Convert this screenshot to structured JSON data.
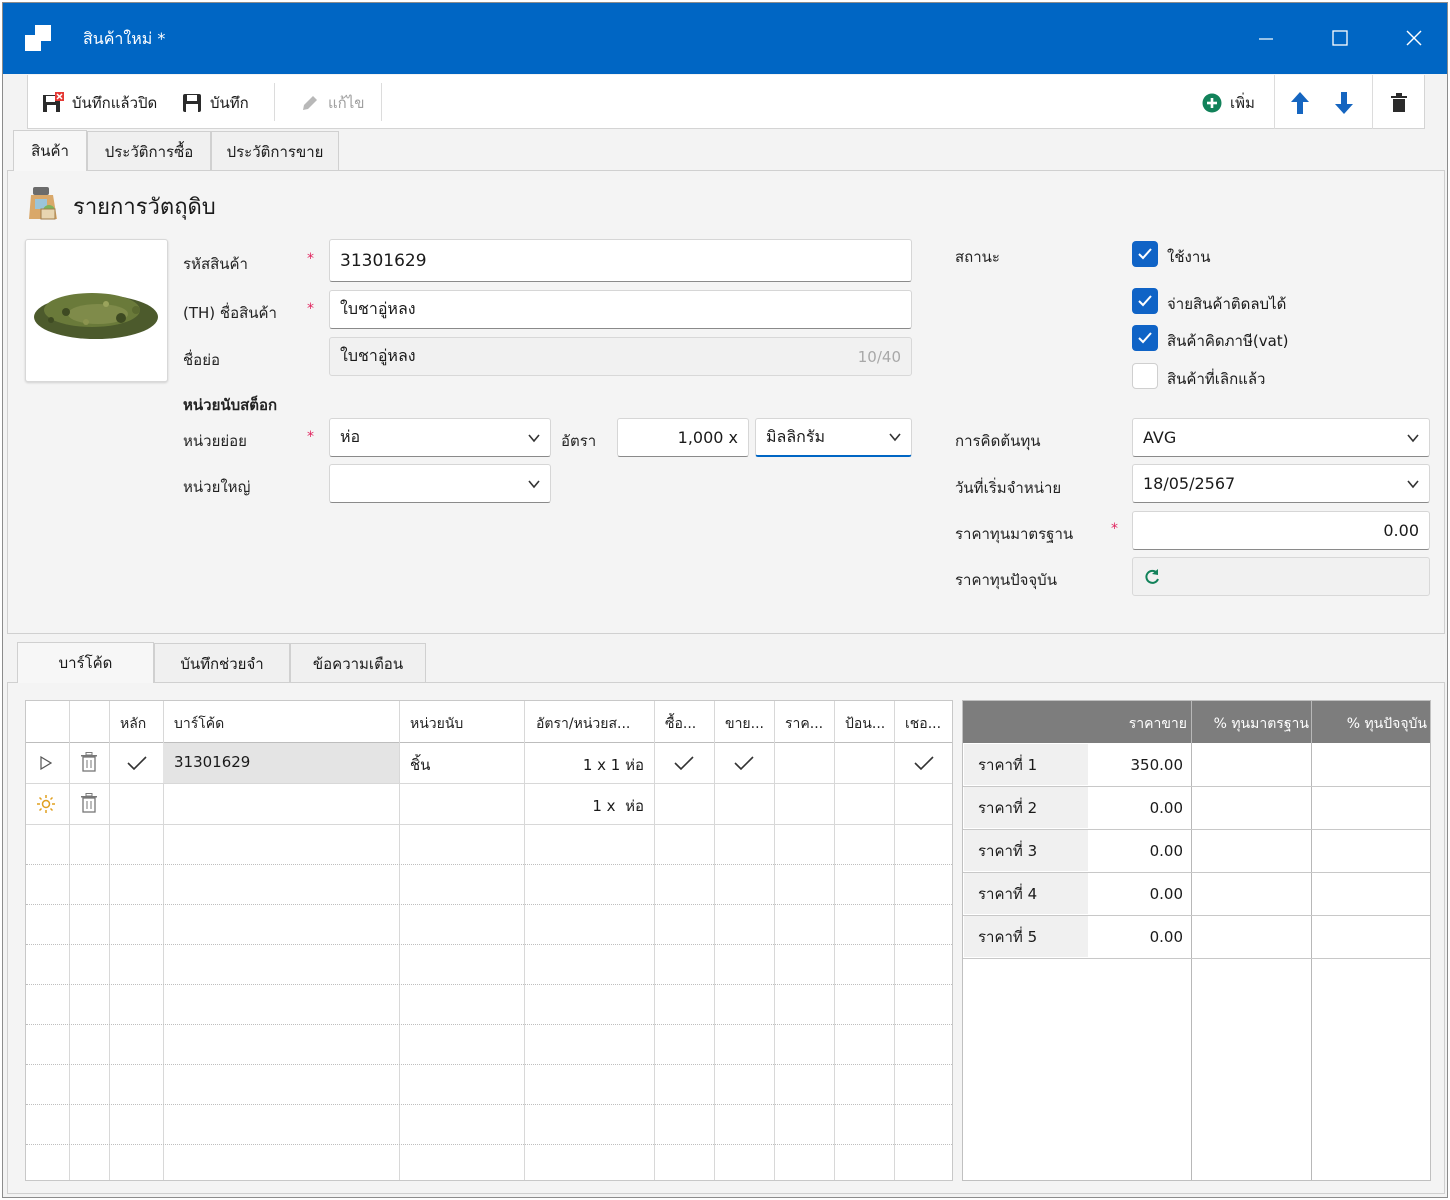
{
  "window": {
    "title": "สินค้าใหม่ *"
  },
  "toolbar": {
    "save_close": "บันทึกแล้วปิด",
    "save": "บันทึก",
    "edit": "แก้ไข",
    "add": "เพิ่ม"
  },
  "top_tabs": [
    "สินค้า",
    "ประวัติการซื้อ",
    "ประวัติการขาย"
  ],
  "section": {
    "title": "รายการวัตถุดิบ"
  },
  "form": {
    "code_label": "รหัสสินค้า",
    "code_value": "31301629",
    "name_label": "(TH) ชื่อสินค้า",
    "name_value": "ใบชาอู่หลง",
    "short_label": "ชื่อย่อ",
    "short_value": "ใบชาอู่หลง",
    "short_counter": "10/40",
    "stock_unit_heading": "หน่วยนับสต็อก",
    "small_unit_label": "หน่วยย่อย",
    "small_unit_value": "ห่อ",
    "rate_label": "อัตรา",
    "rate_value": "1,000 x",
    "rate_unit_value": "มิลลิกรัม",
    "large_unit_label": "หน่วยใหญ่",
    "large_unit_value": ""
  },
  "right_form": {
    "status_label": "สถานะ",
    "active_label": "ใช้งาน",
    "negative_stock_label": "จ่ายสินค้าติดลบได้",
    "vat_label": "สินค้าคิดภาษี(vat)",
    "discontinued_label": "สินค้าที่เลิกแล้ว",
    "active_checked": true,
    "negative_stock_checked": true,
    "vat_checked": true,
    "discontinued_checked": false,
    "costing_label": "การคิดต้นทุน",
    "costing_value": "AVG",
    "start_date_label": "วันที่เริ่มจำหน่าย",
    "start_date_value": "18/05/2567",
    "std_cost_label": "ราคาทุนมาตรฐาน",
    "std_cost_value": "0.00",
    "current_cost_label": "ราคาทุนปัจจุบัน"
  },
  "bottom_tabs": [
    "บาร์โค้ด",
    "บันทึกช่วยจำ",
    "ข้อความเตือน"
  ],
  "barcode_grid": {
    "columns": [
      "หลัก",
      "บาร์โค้ด",
      "หน่วยนับ",
      "อัตรา/หน่วยส...",
      "ซื้อ...",
      "ขาย...",
      "ราค...",
      "ป้อน...",
      "เชอ..."
    ],
    "rows": [
      {
        "main": true,
        "barcode": "31301629",
        "unit": "ชิ้น",
        "rate": "1 x 1 ห่อ",
        "buy": true,
        "sell": true,
        "col7": false,
        "col8": false,
        "col9": true
      },
      {
        "main": false,
        "barcode": "",
        "unit": "",
        "rate": "1 x  ห่อ",
        "buy": false,
        "sell": false,
        "col7": false,
        "col8": false,
        "col9": false
      }
    ]
  },
  "price_table": {
    "headers": [
      "ราคาขาย",
      "% ทุนมาตรฐาน",
      "% ทุนปัจจุบัน"
    ],
    "rows": [
      {
        "label": "ราคาที่ 1",
        "value": "350.00"
      },
      {
        "label": "ราคาที่ 2",
        "value": "0.00"
      },
      {
        "label": "ราคาที่ 3",
        "value": "0.00"
      },
      {
        "label": "ราคาที่ 4",
        "value": "0.00"
      },
      {
        "label": "ราคาที่ 5",
        "value": "0.00"
      }
    ]
  },
  "colors": {
    "accent": "#0066c4",
    "checkbox": "#0f63c6",
    "required": "#e0245e",
    "add_icon": "#12825a"
  }
}
